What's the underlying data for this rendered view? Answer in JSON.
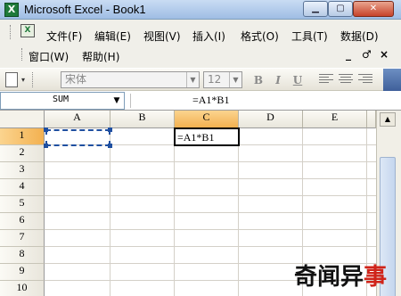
{
  "window": {
    "title": "Microsoft Excel - Book1",
    "app_icon": "X"
  },
  "menu": {
    "row1": [
      "文件(F)",
      "编辑(E)",
      "视图(V)",
      "插入(I)",
      "格式(O)",
      "工具(T)",
      "数据(D)"
    ],
    "row2": [
      "窗口(W)",
      "帮助(H)"
    ],
    "mdi_minimize": "_",
    "mdi_restore": "♂",
    "mdi_close": "×"
  },
  "toolbar": {
    "font_name": "宋体",
    "font_size": "12",
    "bold": "B",
    "italic": "I",
    "underline": "U"
  },
  "formula_bar": {
    "name_box": "SUM",
    "formula": "=A1*B1"
  },
  "sheet": {
    "columns": [
      "A",
      "B",
      "C",
      "D",
      "E"
    ],
    "rows": [
      "1",
      "2",
      "3",
      "4",
      "5",
      "6",
      "7",
      "8",
      "9",
      "10"
    ],
    "active_cell": "C1",
    "active_cell_value": "=A1*B1"
  },
  "watermark": {
    "text1": "奇闻异",
    "text2": "事"
  }
}
